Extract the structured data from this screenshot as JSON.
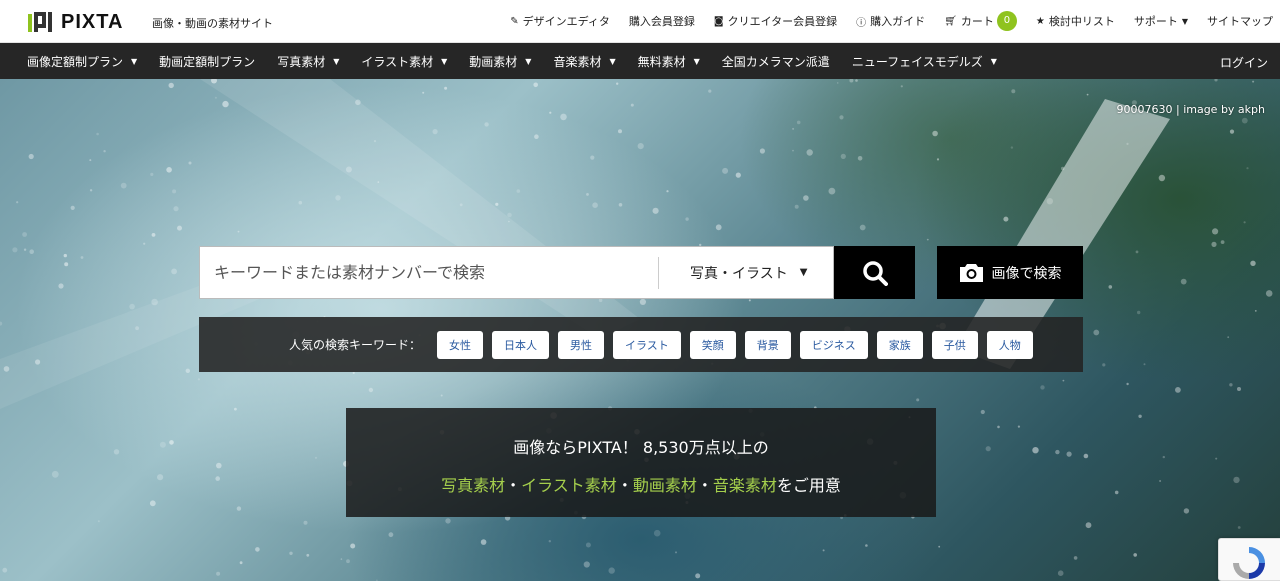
{
  "brand": {
    "logo_text": "PIXTA",
    "tagline": "画像・動画の素材サイト"
  },
  "top_links": {
    "design_editor": "デザインエディタ",
    "buyer_signup": "購入会員登録",
    "creator_signup": "クリエイター会員登録",
    "purchase_guide": "購入ガイド",
    "cart": "カート",
    "cart_count": "0",
    "watchlist": "検討中リスト",
    "support": "サポート",
    "sitemap": "サイトマップ"
  },
  "nav": {
    "items": [
      {
        "label": "画像定額制プラン",
        "dropdown": true
      },
      {
        "label": "動画定額制プラン",
        "dropdown": false
      },
      {
        "label": "写真素材",
        "dropdown": true
      },
      {
        "label": "イラスト素材",
        "dropdown": true
      },
      {
        "label": "動画素材",
        "dropdown": true
      },
      {
        "label": "音楽素材",
        "dropdown": true
      },
      {
        "label": "無料素材",
        "dropdown": true
      },
      {
        "label": "全国カメラマン派遣",
        "dropdown": false
      },
      {
        "label": "ニューフェイスモデルズ",
        "dropdown": true
      }
    ],
    "login": "ログイン"
  },
  "hero": {
    "credit": "90007630 | image by akph",
    "search": {
      "placeholder": "キーワードまたは素材ナンバーで検索",
      "category": "写真・イラスト",
      "image_search_label": "画像で検索"
    },
    "popular": {
      "label": "人気の検索キーワード：",
      "tags": [
        "女性",
        "日本人",
        "男性",
        "イラスト",
        "笑顔",
        "背景",
        "ビジネス",
        "家族",
        "子供",
        "人物"
      ]
    },
    "promo": {
      "line1": "画像ならPIXTA！ 8,530万点以上の",
      "photo": "写真素材",
      "illust": "イラスト素材",
      "video": "動画素材",
      "music": "音楽素材",
      "sep": "・",
      "suffix": "をご用意"
    }
  },
  "colors": {
    "accent_green": "#8fc31f",
    "highlight_green": "#a5cf4c",
    "nav_bg": "#262626",
    "tag_text": "#2a5aa0"
  }
}
